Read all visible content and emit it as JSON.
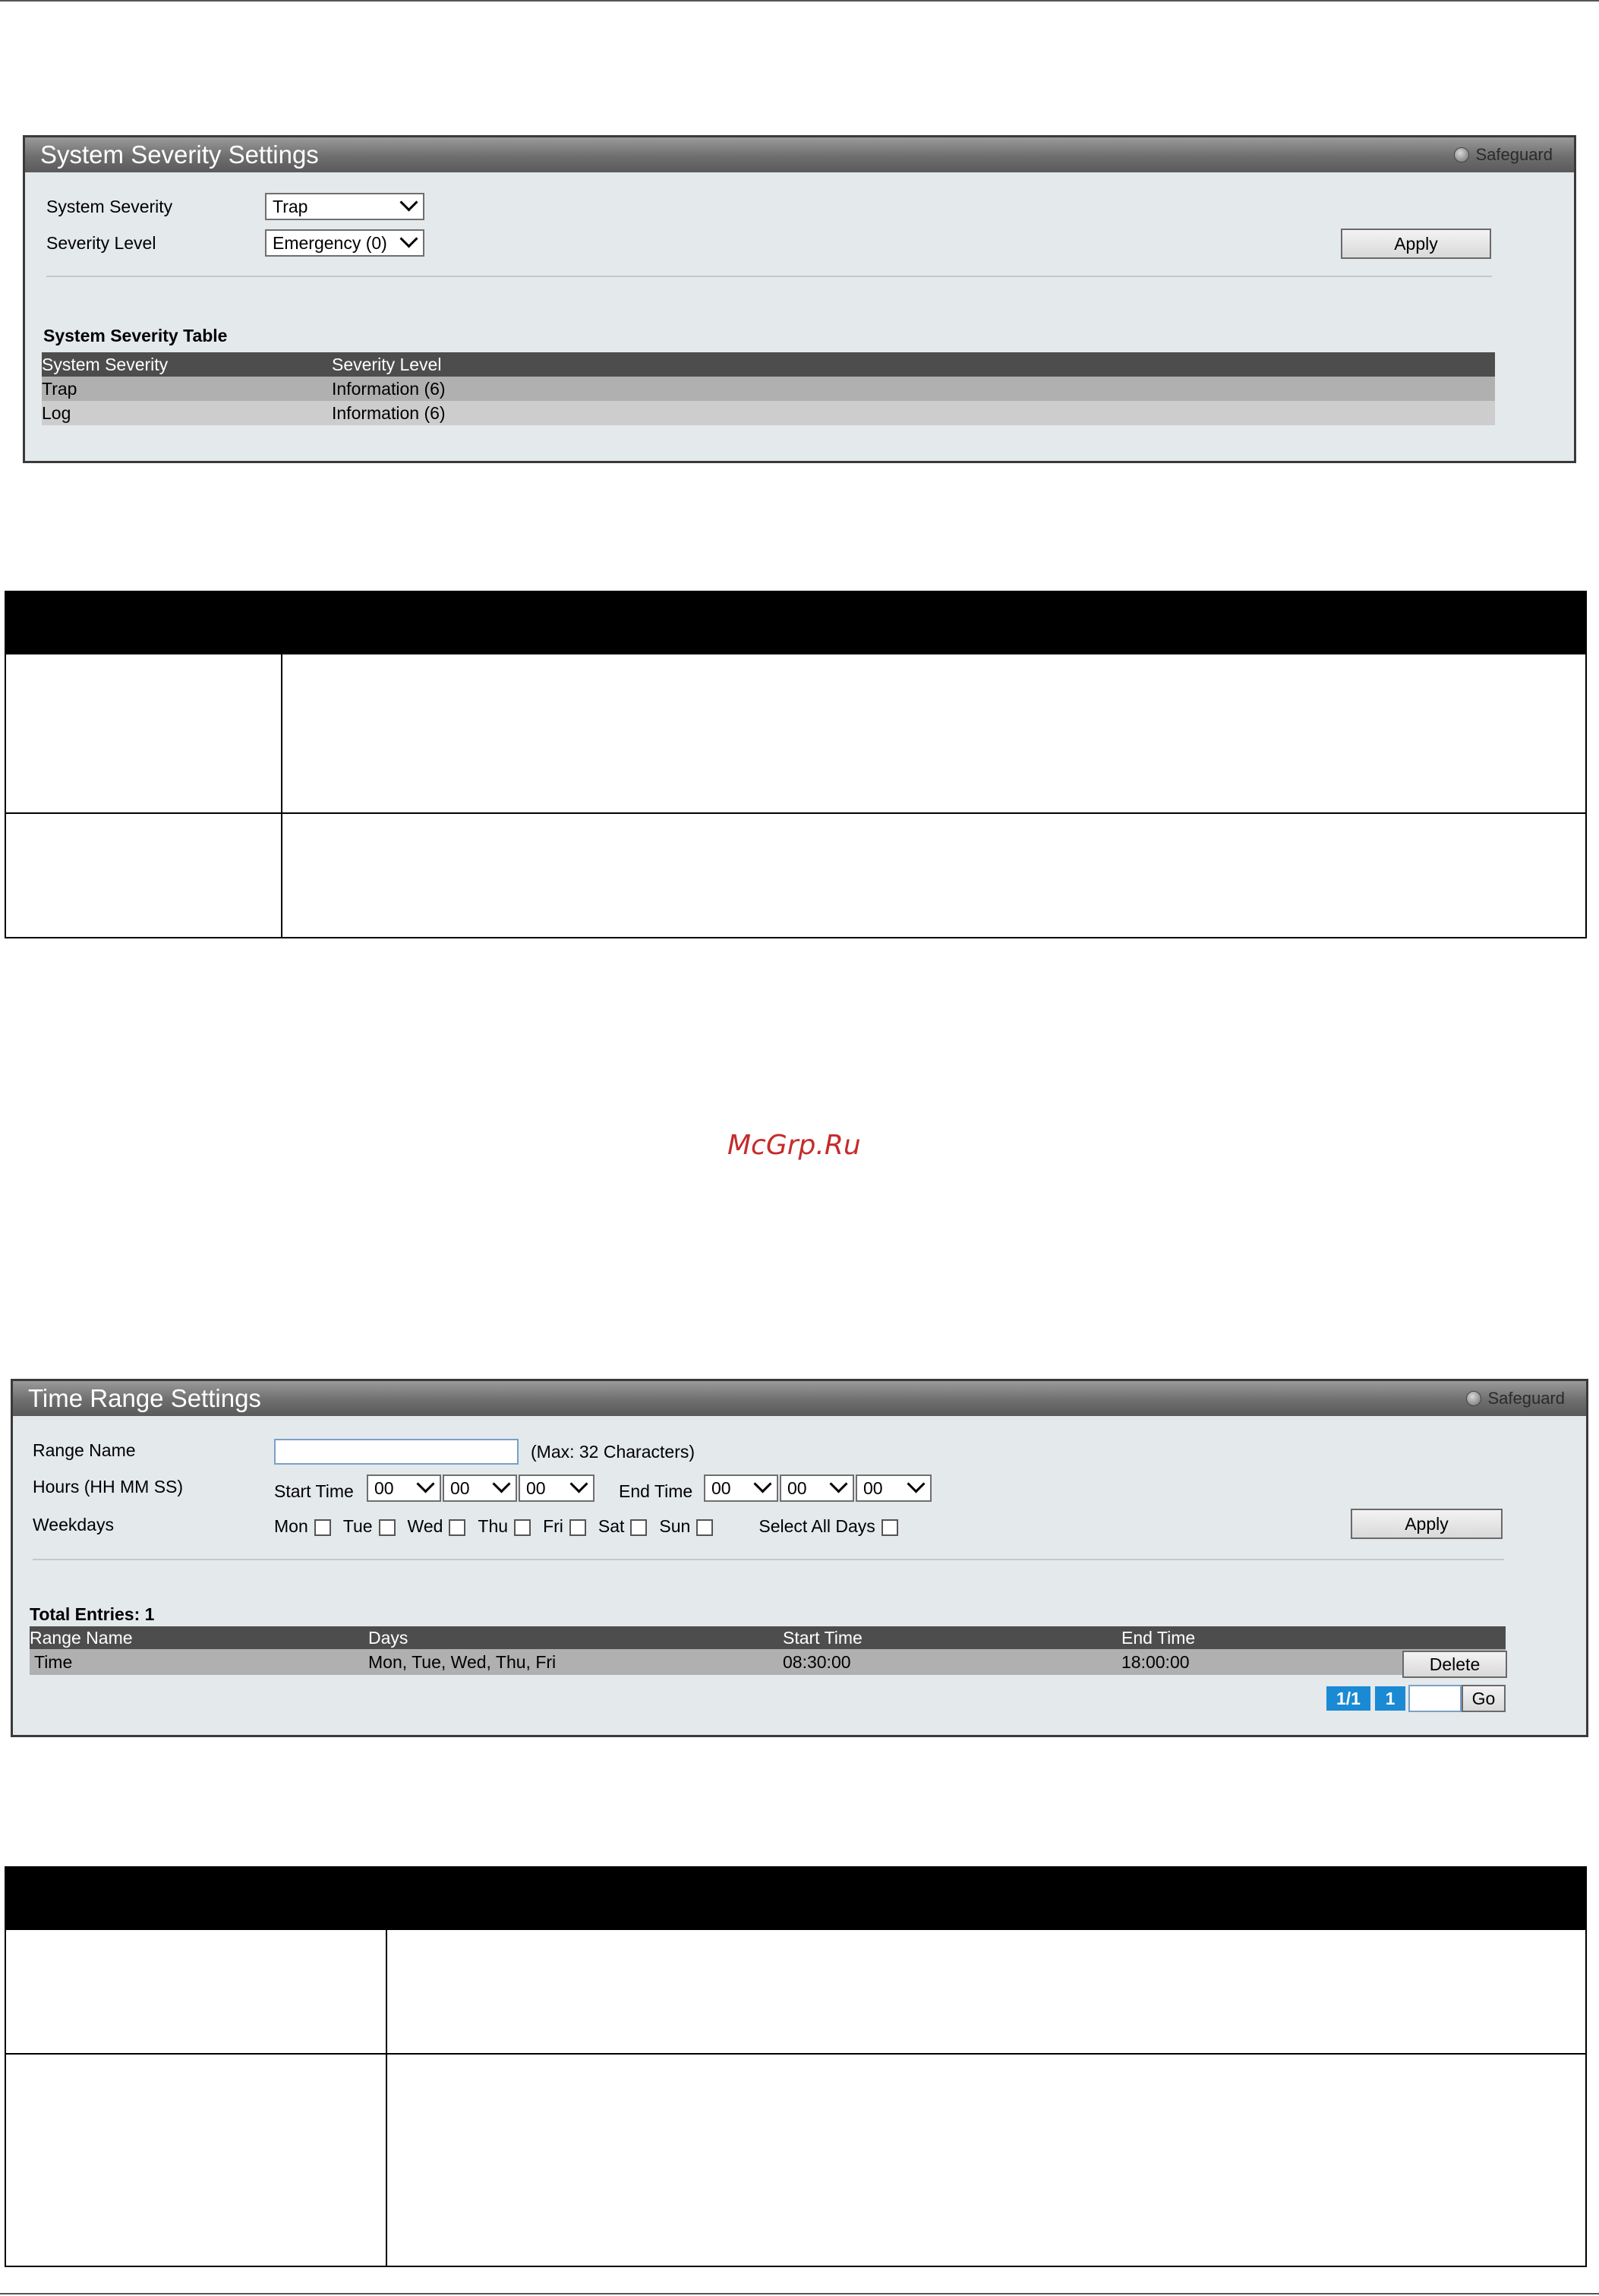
{
  "severity_panel": {
    "title": "System Severity Settings",
    "safeguard": "Safeguard",
    "system_severity_label": "System Severity",
    "system_severity_value": "Trap",
    "severity_level_label": "Severity Level",
    "severity_level_value": "Emergency (0)",
    "apply_label": "Apply",
    "table_title": "System Severity Table",
    "columns": [
      "System Severity",
      "Severity Level"
    ],
    "rows": [
      [
        "Trap",
        "Information (6)"
      ],
      [
        "Log",
        "Information (6)"
      ]
    ]
  },
  "watermark": "McGrp.Ru",
  "time_panel": {
    "title": "Time Range Settings",
    "safeguard": "Safeguard",
    "range_name_label": "Range Name",
    "range_name_value": "",
    "range_name_hint": "(Max: 32 Characters)",
    "hours_label": "Hours (HH MM SS)",
    "start_time_label": "Start Time",
    "start_time": [
      "00",
      "00",
      "00"
    ],
    "end_time_label": "End Time",
    "end_time": [
      "00",
      "00",
      "00"
    ],
    "weekdays_label": "Weekdays",
    "days": [
      "Mon",
      "Tue",
      "Wed",
      "Thu",
      "Fri",
      "Sat",
      "Sun"
    ],
    "select_all_label": "Select All Days",
    "apply_label": "Apply",
    "total_entries": "Total Entries: 1",
    "columns": [
      "Range Name",
      "Days",
      "Start Time",
      "End Time"
    ],
    "rows": [
      [
        "Time",
        "Mon, Tue, Wed, Thu, Fri",
        "08:30:00",
        "18:00:00"
      ]
    ],
    "delete_label": "Delete",
    "pagination": {
      "page_of": "1/1",
      "page": "1",
      "go_label": "Go"
    }
  }
}
